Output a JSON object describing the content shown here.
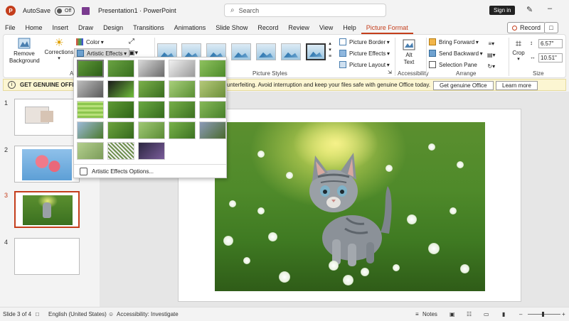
{
  "titlebar": {
    "autosave_label": "AutoSave",
    "autosave_state": "Off",
    "doc_title": "Presentation1 · PowerPoint",
    "search_placeholder": "Search",
    "signin_label": "Sign in"
  },
  "tabs": [
    {
      "label": "File"
    },
    {
      "label": "Home"
    },
    {
      "label": "Insert"
    },
    {
      "label": "Draw"
    },
    {
      "label": "Design"
    },
    {
      "label": "Transitions"
    },
    {
      "label": "Animations"
    },
    {
      "label": "Slide Show"
    },
    {
      "label": "Record"
    },
    {
      "label": "Review"
    },
    {
      "label": "View"
    },
    {
      "label": "Help"
    },
    {
      "label": "Picture Format",
      "active": true
    }
  ],
  "record_button": "Record",
  "ribbon": {
    "remove_background": "Remove Background",
    "corrections": "Corrections",
    "color": "Color",
    "artistic_effects": "Artistic Effects",
    "picture_border": "Picture Border",
    "picture_effects": "Picture Effects",
    "picture_layout": "Picture Layout",
    "alt_text": "Alt Text",
    "bring_forward": "Bring Forward",
    "send_backward": "Send Backward",
    "selection_pane": "Selection Pane",
    "crop": "Crop",
    "height_value": "6.57\"",
    "width_value": "10.51\"",
    "group_picture_styles": "Picture Styles",
    "group_accessibility": "Accessibility",
    "group_arrange": "Arrange",
    "group_size": "Size",
    "group_adjust_fragment": "Ac"
  },
  "message_bar": {
    "title": "GET GENUINE OFFICE",
    "text": "unterfeiting. Avoid interruption and keep your files safe with genuine Office today.",
    "get_button": "Get genuine Office",
    "learn_button": "Learn more"
  },
  "slides": [
    {
      "number": "1"
    },
    {
      "number": "2"
    },
    {
      "number": "3",
      "active": true
    },
    {
      "number": "4"
    }
  ],
  "gallery": {
    "options_label": "Artistic Effects Options..."
  },
  "statusbar": {
    "slide_info": "Slide 3 of 4",
    "language": "English (United States)",
    "accessibility": "Accessibility: Investigate",
    "notes": "Notes"
  },
  "colors": {
    "accent": "#c43e1c",
    "message_bar_bg": "#fcf6d2"
  }
}
